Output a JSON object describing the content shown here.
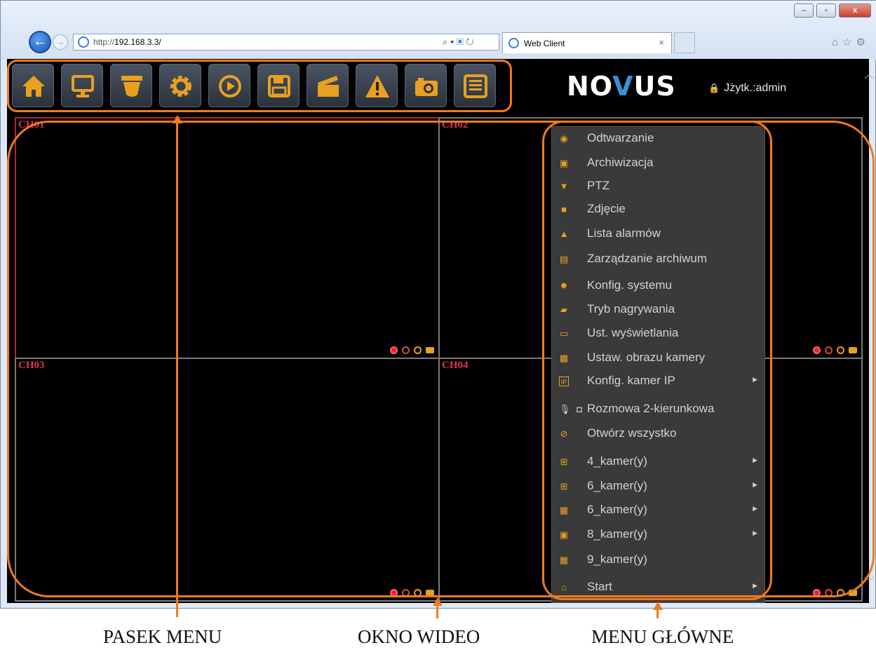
{
  "browser": {
    "url_prefix": "http://",
    "url_host": "192.168.3.3/",
    "tab_title": "Web Client",
    "tab_close": "×",
    "window_buttons": [
      "–",
      "▫",
      "x"
    ]
  },
  "client": {
    "logo": {
      "pre": "NO",
      "v": "V",
      "post": "US"
    },
    "user_text": "Jżytk.:admin",
    "toolbar_icons": [
      "home-icon",
      "monitor-icon",
      "ptz-camera-icon",
      "settings-gear-icon",
      "playback-icon",
      "save-archive-icon",
      "clapperboard-icon",
      "alarm-warning-icon",
      "snapshot-camera-icon",
      "archive-list-icon"
    ],
    "channels": [
      {
        "label": "CH01",
        "active": true
      },
      {
        "label": "CH02",
        "active": false
      },
      {
        "label": "CH03",
        "active": false
      },
      {
        "label": "CH04",
        "active": false
      }
    ],
    "menu": [
      {
        "label": "Odtwarzanie",
        "icon": "playback-icon",
        "submenu": false
      },
      {
        "label": "Archiwizacja",
        "icon": "save-icon",
        "submenu": false
      },
      {
        "label": "PTZ",
        "icon": "ptz-icon",
        "submenu": false
      },
      {
        "label": "Zdjęcie",
        "icon": "camera-icon",
        "submenu": false
      },
      {
        "label": "Lista alarmów",
        "icon": "warning-icon",
        "submenu": false
      },
      {
        "label": "Zarządzanie archiwum",
        "icon": "list-icon",
        "submenu": false
      },
      {
        "label": "Konfig. systemu",
        "icon": "gear-icon",
        "submenu": false
      },
      {
        "label": "Tryb nagrywania",
        "icon": "clapperboard-icon",
        "submenu": false
      },
      {
        "label": "Ust. wyświetlania",
        "icon": "monitor-icon",
        "submenu": false
      },
      {
        "label": "Ustaw. obrazu kamery",
        "icon": "image-icon",
        "submenu": false
      },
      {
        "label": "Konfig. kamer IP",
        "icon": "ip-icon",
        "submenu": true
      },
      {
        "label": "Rozmowa 2-kierunkowa",
        "icon": "microphone-icon",
        "submenu": false
      },
      {
        "label": "Otwórz wszystko",
        "icon": "open-all-icon",
        "submenu": false
      },
      {
        "label": "4_kamer(y)",
        "icon": "grid-4-icon",
        "submenu": true
      },
      {
        "label": "6_kamer(y)",
        "icon": "grid-6-icon",
        "submenu": true
      },
      {
        "label": "6_kamer(y)",
        "icon": "grid-6b-icon",
        "submenu": true
      },
      {
        "label": "8_kamer(y)",
        "icon": "grid-8-icon",
        "submenu": true
      },
      {
        "label": "9_kamer(y)",
        "icon": "grid-9-icon",
        "submenu": false
      },
      {
        "label": "Start",
        "icon": "home-icon",
        "submenu": true
      }
    ]
  },
  "captions": {
    "menu_bar": "PASEK MENU",
    "video_window": "OKNO WIDEO",
    "main_menu": "MENU GŁÓWNE"
  },
  "colors": {
    "annotation": "#ef7a1e",
    "icon_orange": "#e8a020",
    "channel_label": "#d8365a"
  }
}
